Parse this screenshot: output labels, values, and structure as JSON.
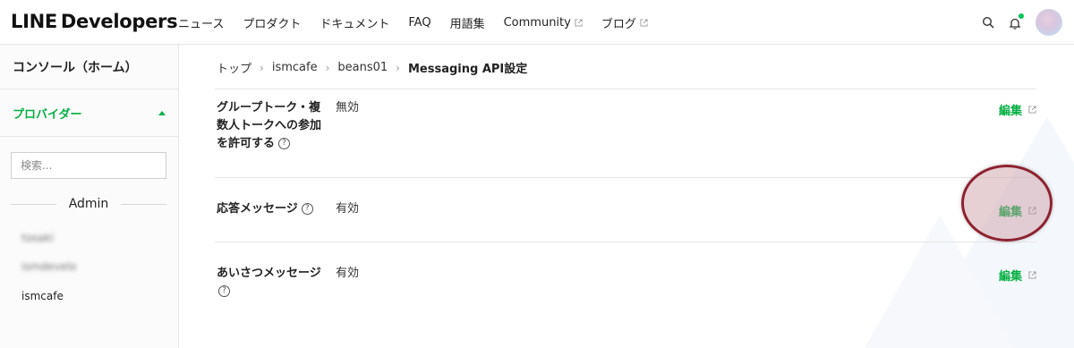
{
  "header": {
    "logo_line": "LINE",
    "logo_dev": "Developers",
    "nav": [
      {
        "label": "ニュース",
        "external": false
      },
      {
        "label": "プロダクト",
        "external": false
      },
      {
        "label": "ドキュメント",
        "external": false
      },
      {
        "label": "FAQ",
        "external": false
      },
      {
        "label": "用語集",
        "external": false
      },
      {
        "label": "Community",
        "external": true
      },
      {
        "label": "ブログ",
        "external": true
      }
    ],
    "icons": [
      "search-icon",
      "bell-icon",
      "avatar"
    ]
  },
  "sidebar": {
    "console": "コンソール（ホーム）",
    "provider": "プロバイダー",
    "search_placeholder": "検索...",
    "admin_label": "Admin",
    "items": [
      "tosaki",
      "ismdevelo",
      "ismcafe"
    ]
  },
  "breadcrumb": {
    "items": [
      "トップ",
      "ismcafe",
      "beans01"
    ],
    "current": "Messaging API設定"
  },
  "settings": [
    {
      "label": "グループトーク・複数人トークへの参加を許可する",
      "value": "無効",
      "edit": "編集"
    },
    {
      "label": "応答メッセージ",
      "value": "有効",
      "edit": "編集"
    },
    {
      "label": "あいさつメッセージ",
      "value": "有効",
      "edit": "編集"
    }
  ],
  "help_glyph": "?",
  "colors": {
    "accent": "#06b044",
    "highlight_ring": "#8e2230"
  }
}
